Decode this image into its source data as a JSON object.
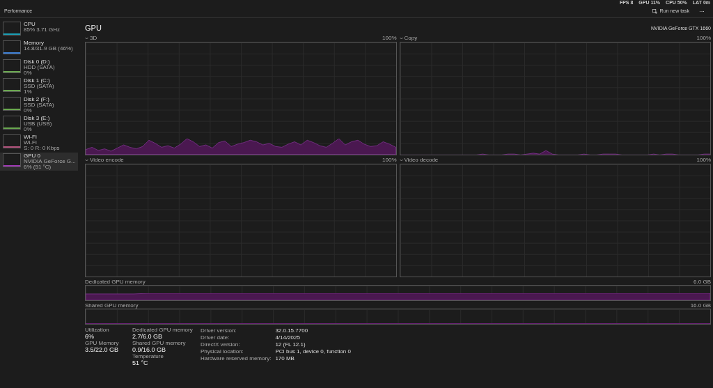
{
  "overlay": [
    "FPS  8",
    "GPU 11%",
    "CPU 50%",
    "LAT 0m"
  ],
  "header": {
    "title": "Performance",
    "run_task": "Run new task",
    "more": "···"
  },
  "sidebar": {
    "items": [
      {
        "name": "CPU",
        "detail": "85% 3.71 GHz",
        "color": "#1a9fb5",
        "selected": false
      },
      {
        "name": "Memory",
        "detail": "14.8/31.9 GB (46%)",
        "color": "#3d7fd6",
        "selected": false
      },
      {
        "name": "Disk 0 (D:)",
        "detail": "HDD (SATA)",
        "value": "0%",
        "color": "#6aa84f",
        "selected": false
      },
      {
        "name": "Disk 1 (C:)",
        "detail": "SSD (SATA)",
        "value": "1%",
        "color": "#6aa84f",
        "selected": false
      },
      {
        "name": "Disk 2 (F:)",
        "detail": "SSD (SATA)",
        "value": "0%",
        "color": "#6aa84f",
        "selected": false
      },
      {
        "name": "Disk 3 (E:)",
        "detail": "USB (USB)",
        "value": "0%",
        "color": "#6aa84f",
        "selected": false
      },
      {
        "name": "Wi-Fi",
        "detail": "Wi-Fi",
        "value": "S: 0 R: 0 Kbps",
        "color": "#b0507a",
        "selected": false
      },
      {
        "name": "GPU 0",
        "detail": "NVIDIA GeForce G...",
        "value": "6% (51 °C)",
        "color": "#9b35b0",
        "selected": true
      }
    ]
  },
  "main": {
    "title": "GPU",
    "device": "NVIDIA GeForce GTX 1660",
    "engines": [
      {
        "label": "3D",
        "max": "100%"
      },
      {
        "label": "Copy",
        "max": "100%"
      },
      {
        "label": "Video encode",
        "max": "100%"
      },
      {
        "label": "Video decode",
        "max": "100%"
      }
    ],
    "memory_charts": [
      {
        "label": "Dedicated GPU memory",
        "max": "6.0 GB"
      },
      {
        "label": "Shared GPU memory",
        "max": "16.0 GB"
      }
    ],
    "stats": [
      {
        "label": "Utilization",
        "value": "6%"
      },
      {
        "label": "GPU Memory",
        "value": "3.5/22.0 GB"
      },
      {
        "label": "Dedicated GPU memory",
        "value": "2.7/6.0 GB"
      },
      {
        "label": "Shared GPU memory",
        "value": "0.9/16.0 GB"
      },
      {
        "label": "Temperature",
        "value": "51 °C"
      }
    ],
    "properties": [
      {
        "label": "Driver version:",
        "value": "32.0.15.7700"
      },
      {
        "label": "Driver date:",
        "value": "4/14/2025"
      },
      {
        "label": "DirectX version:",
        "value": "12 (FL 12.1)"
      },
      {
        "label": "Physical location:",
        "value": "PCI bus 1, device 0, function 0"
      },
      {
        "label": "Hardware reserved memory:",
        "value": "170 MB"
      }
    ]
  }
}
